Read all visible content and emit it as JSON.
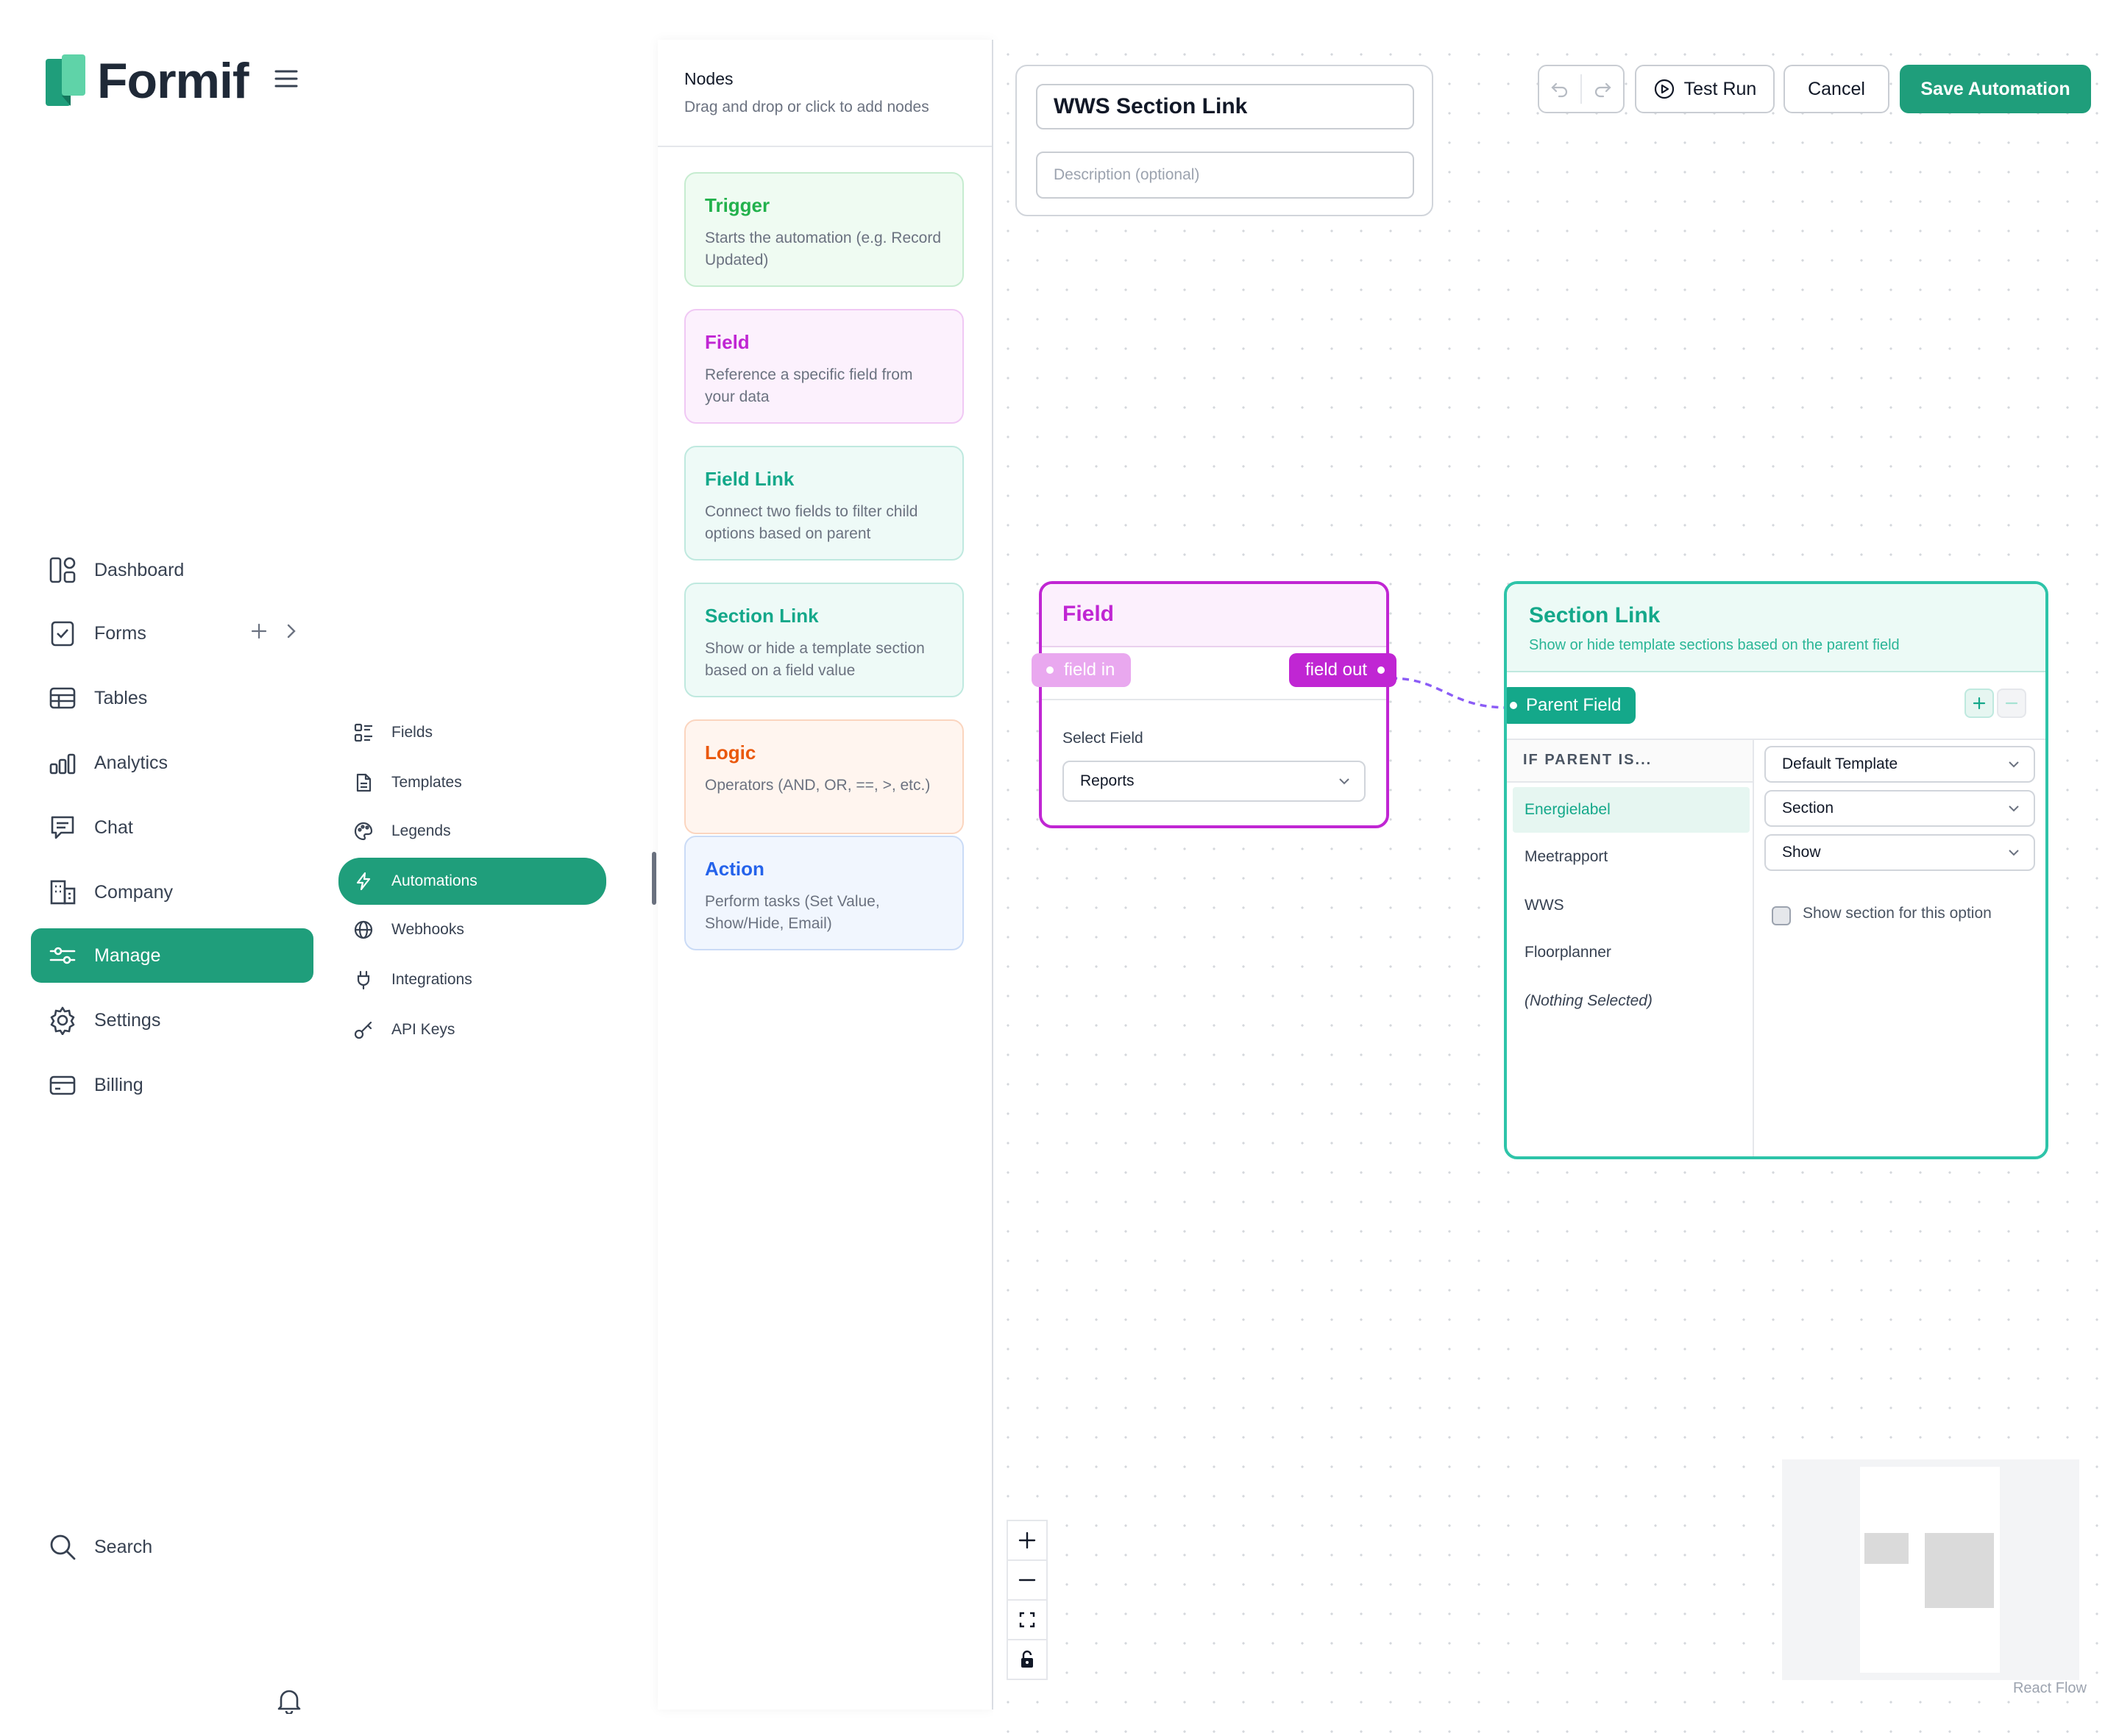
{
  "brand": {
    "name": "Formif",
    "accent": "#1f9e7b"
  },
  "nav": [
    {
      "label": "Dashboard",
      "icon": "dashboard-icon"
    },
    {
      "label": "Forms",
      "icon": "forms-icon"
    },
    {
      "label": "Tables",
      "icon": "tables-icon"
    },
    {
      "label": "Analytics",
      "icon": "analytics-icon"
    },
    {
      "label": "Chat",
      "icon": "chat-icon"
    },
    {
      "label": "Company",
      "icon": "company-icon"
    },
    {
      "label": "Manage",
      "icon": "sliders-icon",
      "active": true
    },
    {
      "label": "Settings",
      "icon": "gear-icon"
    },
    {
      "label": "Billing",
      "icon": "card-icon"
    }
  ],
  "search_label": "Search",
  "subnav": [
    {
      "label": "Fields",
      "icon": "fields-icon"
    },
    {
      "label": "Templates",
      "icon": "document-icon"
    },
    {
      "label": "Legends",
      "icon": "palette-icon"
    },
    {
      "label": "Automations",
      "icon": "bolt-icon",
      "active": true
    },
    {
      "label": "Webhooks",
      "icon": "globe-icon"
    },
    {
      "label": "Integrations",
      "icon": "plug-icon"
    },
    {
      "label": "API Keys",
      "icon": "key-icon"
    }
  ],
  "nodes_panel": {
    "title": "Nodes",
    "subtitle": "Drag and drop or click to add nodes",
    "cards": [
      {
        "title": "Trigger",
        "desc": "Starts the automation (e.g. Record Updated)",
        "color": "#22b14c"
      },
      {
        "title": "Field",
        "desc": "Reference a specific field from your data",
        "color": "#c026d3"
      },
      {
        "title": "Field Link",
        "desc": "Connect two fields to filter child options based on parent",
        "color": "#14a88a"
      },
      {
        "title": "Section Link",
        "desc": "Show or hide a template section based on a field value",
        "color": "#14a88a"
      },
      {
        "title": "Logic",
        "desc": "Operators (AND, OR, ==, >, etc.)",
        "color": "#ea580c"
      },
      {
        "title": "Action",
        "desc": "Perform tasks (Set Value, Show/Hide, Email)",
        "color": "#2563eb"
      }
    ]
  },
  "automation": {
    "name": "WWS Section Link",
    "description_placeholder": "Description (optional)"
  },
  "toolbar": {
    "test_run": "Test Run",
    "cancel": "Cancel",
    "save": "Save Automation"
  },
  "field_node": {
    "title": "Field",
    "handle_in": "field in",
    "handle_out": "field out",
    "select_label": "Select Field",
    "selected": "Reports"
  },
  "section_link_node": {
    "title": "Section Link",
    "subtitle": "Show or hide template sections based on the parent field",
    "handle": "Parent Field",
    "column_header": "IF PARENT IS...",
    "options": [
      "Energielabel",
      "Meetrapport",
      "WWS",
      "Floorplanner",
      "(Nothing Selected)"
    ],
    "selected_option": "Energielabel",
    "template_select": "Default Template",
    "section_select": "Section",
    "action_select": "Show",
    "checkbox_label": "Show section for this option"
  },
  "attribution": "React Flow"
}
